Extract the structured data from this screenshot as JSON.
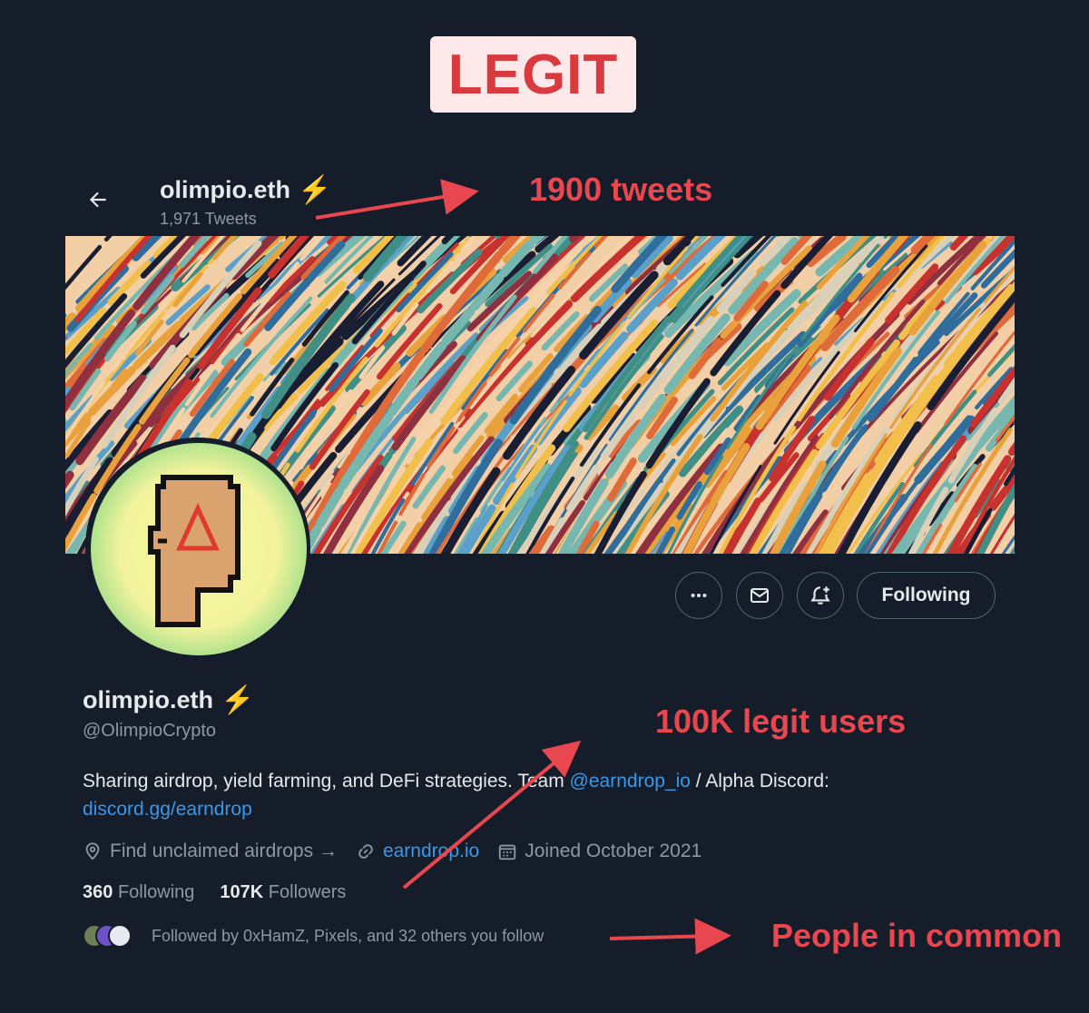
{
  "annotation_badge": {
    "label": "LEGIT"
  },
  "header": {
    "display_name": "olimpio.eth",
    "tweet_count": "1,971 Tweets"
  },
  "annotations": {
    "tweets_note": "1900 tweets",
    "users_note": "100K legit users",
    "common_note": "People in common"
  },
  "actions": {
    "more_icon": "more-icon",
    "message_icon": "envelope-icon",
    "notify_icon": "bell-plus-icon",
    "follow_label": "Following"
  },
  "profile": {
    "display_name": "olimpio.eth",
    "handle": "@OlimpioCrypto",
    "bio_text": "Sharing airdrop, yield farming, and DeFi strategies. Team ",
    "bio_link1": "@earndrop_io",
    "bio_text2": " / Alpha Discord: ",
    "bio_link2": "discord.gg/earndrop",
    "location": "Find unclaimed airdrops →",
    "website": "earndrop.io",
    "joined": "Joined October 2021"
  },
  "stats": {
    "following_count": "360",
    "following_label": "Following",
    "followers_count": "107K",
    "followers_label": "Followers"
  },
  "followed_by": "Followed by 0xHamZ, Pixels, and 32 others you follow",
  "colors": {
    "background": "#151d2a",
    "annotation_red": "#e8474f",
    "link_blue": "#3b97e8",
    "verified_bolt": "#f5b32a"
  }
}
